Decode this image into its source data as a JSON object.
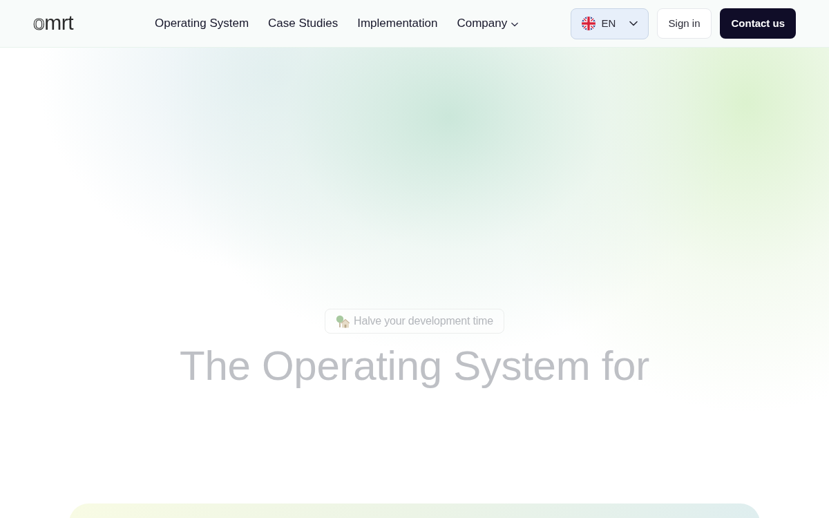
{
  "logo": {
    "text": "omrt"
  },
  "nav": {
    "items": [
      {
        "label": "Operating System",
        "kind": "link"
      },
      {
        "label": "Case Studies",
        "kind": "link"
      },
      {
        "label": "Implementation",
        "kind": "link"
      },
      {
        "label": "Company",
        "kind": "dropdown"
      }
    ]
  },
  "language": {
    "code": "EN"
  },
  "actions": [
    {
      "label": "Sign in",
      "kind": "secondary"
    },
    {
      "label": "Contact us",
      "kind": "primary"
    }
  ],
  "hero": {
    "badge": "Halve your development time",
    "headline": "The Operating System for"
  }
}
